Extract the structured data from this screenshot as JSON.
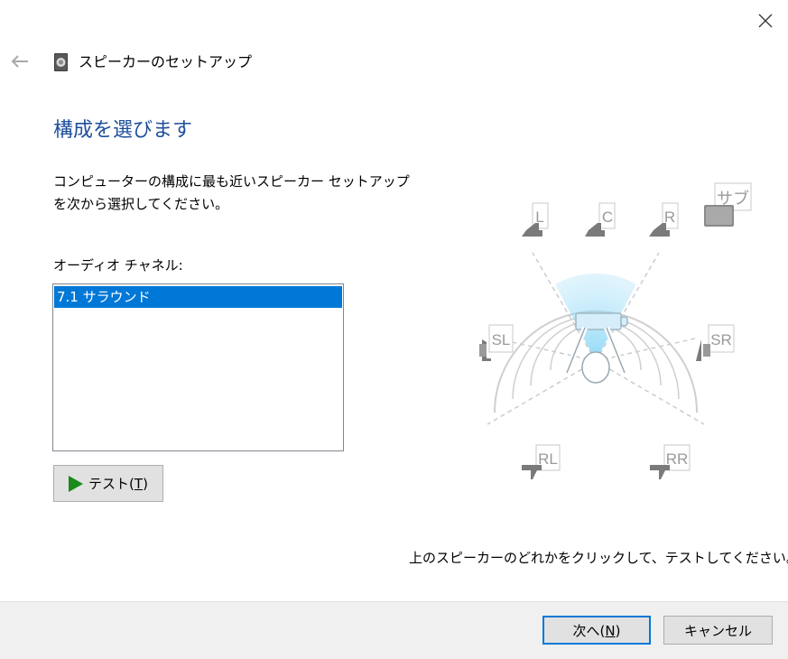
{
  "window": {
    "title": "スピーカーのセットアップ",
    "close_icon": "close-icon",
    "back_icon": "back-arrow-icon"
  },
  "page": {
    "heading": "構成を選びます",
    "description": "コンピューターの構成に最も近いスピーカー セットアップを次から選択してください。",
    "channels_label": "オーディオ チャネル:",
    "channels": [
      {
        "label": "7.1 サラウンド",
        "selected": true
      }
    ],
    "test_button": {
      "label": "テスト(",
      "mnemonic": "T",
      "suffix": ")"
    },
    "hint": "上のスピーカーのどれかをクリックして、テストしてください。"
  },
  "speakers": {
    "front_left": "L",
    "center": "C",
    "front_right": "R",
    "subwoofer": "サブ",
    "side_left": "SL",
    "side_right": "SR",
    "rear_left": "RL",
    "rear_right": "RR"
  },
  "footer": {
    "next": {
      "label": "次へ(",
      "mnemonic": "N",
      "suffix": ")"
    },
    "cancel": "キャンセル"
  },
  "colors": {
    "heading": "#1e4e9c",
    "selection": "#0078d7",
    "play": "#1a8a1a",
    "footer_bg": "#f0f0f0"
  }
}
